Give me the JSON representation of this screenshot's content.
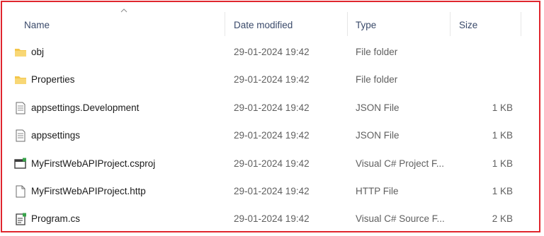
{
  "columns": {
    "name": "Name",
    "date": "Date modified",
    "type": "Type",
    "size": "Size"
  },
  "sort": {
    "column": "name",
    "icon": "chevron-up-icon"
  },
  "rows": [
    {
      "icon": "folder-icon",
      "name": "obj",
      "date": "29-01-2024 19:42",
      "type": "File folder",
      "size": ""
    },
    {
      "icon": "folder-icon",
      "name": "Properties",
      "date": "29-01-2024 19:42",
      "type": "File folder",
      "size": ""
    },
    {
      "icon": "json-file-icon",
      "name": "appsettings.Development",
      "date": "29-01-2024 19:42",
      "type": "JSON File",
      "size": "1 KB"
    },
    {
      "icon": "json-file-icon",
      "name": "appsettings",
      "date": "29-01-2024 19:42",
      "type": "JSON File",
      "size": "1 KB"
    },
    {
      "icon": "csproj-file-icon",
      "name": "MyFirstWebAPIProject.csproj",
      "date": "29-01-2024 19:42",
      "type": "Visual C# Project F...",
      "size": "1 KB"
    },
    {
      "icon": "blank-file-icon",
      "name": "MyFirstWebAPIProject.http",
      "date": "29-01-2024 19:42",
      "type": "HTTP File",
      "size": "1 KB"
    },
    {
      "icon": "csharp-file-icon",
      "name": "Program.cs",
      "date": "29-01-2024 19:42",
      "type": "Visual C# Source F...",
      "size": "2 KB"
    }
  ],
  "colors": {
    "highlight_border": "#e0262e",
    "folder": "#f4c64a"
  }
}
